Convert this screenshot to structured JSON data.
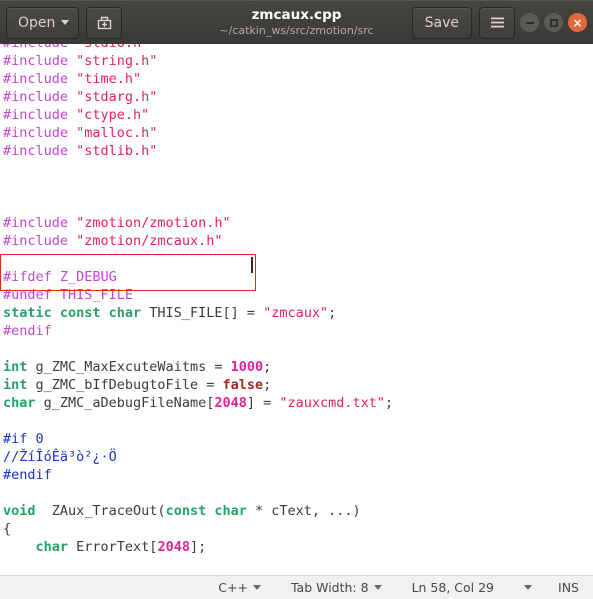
{
  "titlebar": {
    "open_label": "Open",
    "save_label": "Save",
    "new_icon": "new-document-icon",
    "menu_icon": "hamburger-menu-icon",
    "title": "zmcaux.cpp",
    "subtitle": "~/catkin_ws/src/zmotion/src",
    "minimize_icon": "minimize-icon",
    "maximize_icon": "maximize-icon",
    "close_icon": "close-icon",
    "close_glyph": "×",
    "colors": {
      "titlebar_bg": "#3a3935",
      "close_button": "#e3683c",
      "button_text": "#d8d3ca"
    }
  },
  "editor": {
    "colors": {
      "preprocessor": "#c545d3",
      "string": "#e0245e",
      "keyword": "#26a269",
      "number": "#e0259a",
      "boolean": "#a52a2a",
      "inactive_block": "#1a33cc",
      "plain_text": "#3b3b3b",
      "highlight_border": "#e02a18",
      "background": "#ffffff"
    },
    "lines": [
      [
        {
          "t": "#include ",
          "c": "pre"
        },
        {
          "t": "\"stdio.h\"",
          "c": "str"
        }
      ],
      [
        {
          "t": "#include ",
          "c": "pre"
        },
        {
          "t": "\"string.h\"",
          "c": "str"
        }
      ],
      [
        {
          "t": "#include ",
          "c": "pre"
        },
        {
          "t": "\"time.h\"",
          "c": "str"
        }
      ],
      [
        {
          "t": "#include ",
          "c": "pre"
        },
        {
          "t": "\"stdarg.h\"",
          "c": "str"
        }
      ],
      [
        {
          "t": "#include ",
          "c": "pre"
        },
        {
          "t": "\"ctype.h\"",
          "c": "str"
        }
      ],
      [
        {
          "t": "#include ",
          "c": "pre"
        },
        {
          "t": "\"malloc.h\"",
          "c": "str"
        }
      ],
      [
        {
          "t": "#include ",
          "c": "pre"
        },
        {
          "t": "\"stdlib.h\"",
          "c": "str"
        }
      ],
      [],
      [],
      [],
      [
        {
          "t": "#include ",
          "c": "pre"
        },
        {
          "t": "\"zmotion/zmotion.h\"",
          "c": "str"
        }
      ],
      [
        {
          "t": "#include ",
          "c": "pre"
        },
        {
          "t": "\"zmotion/zmcaux.h\"",
          "c": "str"
        }
      ],
      [],
      [
        {
          "t": "#ifdef Z_DEBUG",
          "c": "pre"
        }
      ],
      [
        {
          "t": "#undef THIS_FILE",
          "c": "pre"
        }
      ],
      [
        {
          "t": "static const char",
          "c": "kw"
        },
        {
          "t": " THIS_FILE[] = ",
          "c": "plain"
        },
        {
          "t": "\"zmcaux\"",
          "c": "str"
        },
        {
          "t": ";",
          "c": "plain"
        }
      ],
      [
        {
          "t": "#endif",
          "c": "pre"
        }
      ],
      [],
      [
        {
          "t": "int",
          "c": "kw"
        },
        {
          "t": " g_ZMC_MaxExcuteWaitms = ",
          "c": "plain"
        },
        {
          "t": "1000",
          "c": "num"
        },
        {
          "t": ";",
          "c": "plain"
        }
      ],
      [
        {
          "t": "int",
          "c": "kw"
        },
        {
          "t": " g_ZMC_bIfDebugtoFile = ",
          "c": "plain"
        },
        {
          "t": "false",
          "c": "bool"
        },
        {
          "t": ";",
          "c": "plain"
        }
      ],
      [
        {
          "t": "char",
          "c": "kw"
        },
        {
          "t": " g_ZMC_aDebugFileName[",
          "c": "plain"
        },
        {
          "t": "2048",
          "c": "num"
        },
        {
          "t": "] = ",
          "c": "plain"
        },
        {
          "t": "\"zauxcmd.txt\"",
          "c": "str"
        },
        {
          "t": ";",
          "c": "plain"
        }
      ],
      [],
      [
        {
          "t": "#if 0",
          "c": "inactive"
        }
      ],
      [
        {
          "t": "//ŽíÎóÊä³ò²¿·Ö",
          "c": "inactive"
        }
      ],
      [
        {
          "t": "#endif",
          "c": "inactive"
        }
      ],
      [],
      [
        {
          "t": "void",
          "c": "kw"
        },
        {
          "t": "  ZAux_TraceOut(",
          "c": "plain"
        },
        {
          "t": "const char",
          "c": "kw"
        },
        {
          "t": " * cText, ...)",
          "c": "plain"
        }
      ],
      [
        {
          "t": "{",
          "c": "plain"
        }
      ],
      [
        {
          "t": "    ",
          "c": "plain"
        },
        {
          "t": "char",
          "c": "kw"
        },
        {
          "t": " ErrorText[",
          "c": "plain"
        },
        {
          "t": "2048",
          "c": "num"
        },
        {
          "t": "];",
          "c": "plain"
        }
      ]
    ]
  },
  "statusbar": {
    "language": "C++",
    "tab_width": "Tab Width: 8",
    "cursor_position": "Ln 58, Col 29",
    "insert_mode": "INS"
  }
}
